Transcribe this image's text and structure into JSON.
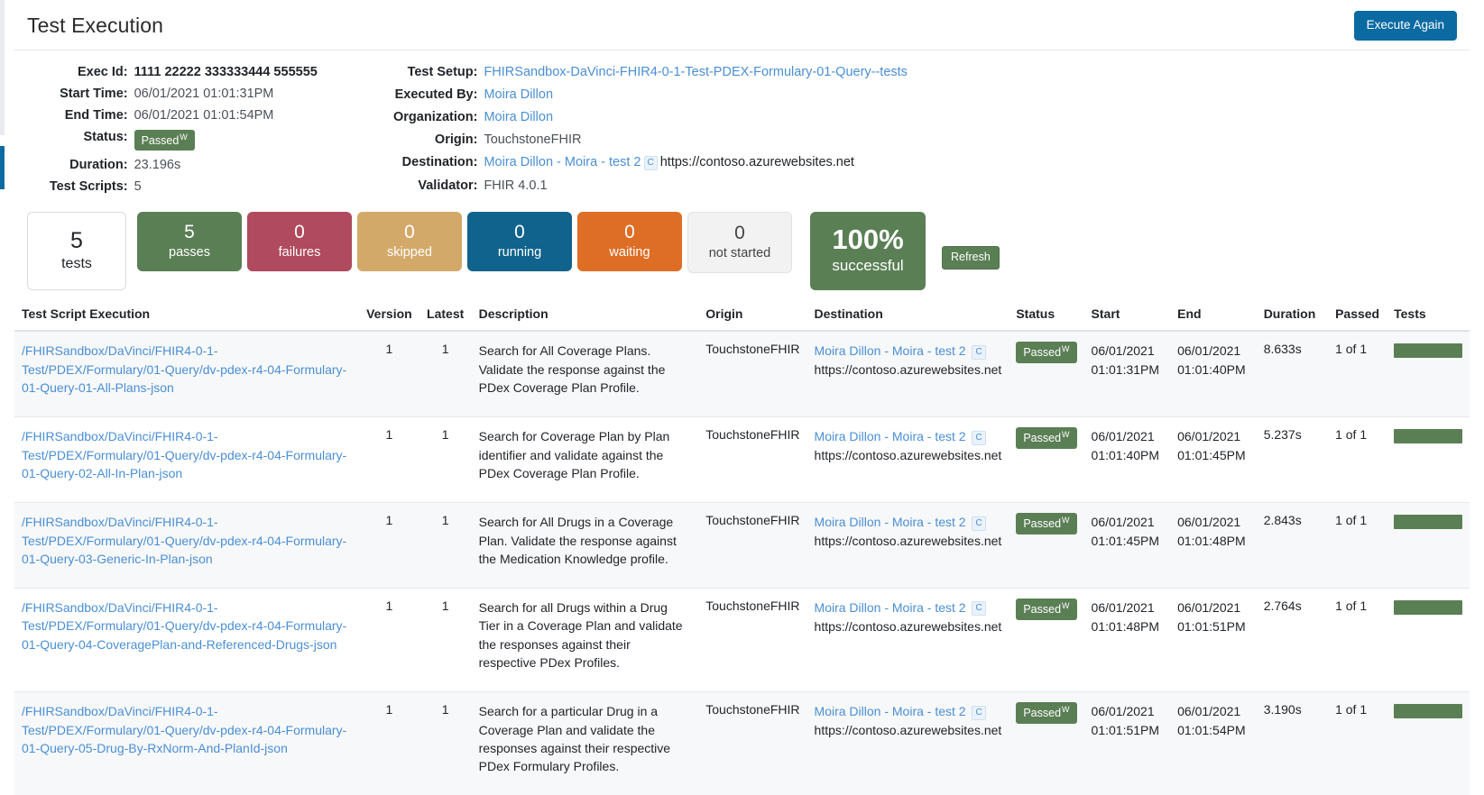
{
  "header": {
    "title": "Test Execution",
    "execute_again_label": "Execute Again"
  },
  "meta": {
    "left": [
      {
        "label": "Exec Id:",
        "value": "1111 22222 333333444 555555",
        "bold": true
      },
      {
        "label": "Start Time:",
        "value": "06/01/2021 01:01:31PM"
      },
      {
        "label": "End Time:",
        "value": "06/01/2021 01:01:54PM"
      },
      {
        "label": "Status:",
        "value": "Passed",
        "badge_sup": "W"
      },
      {
        "label": "Duration:",
        "value": "23.196s"
      },
      {
        "label": "Test Scripts:",
        "value": "5"
      }
    ],
    "right": {
      "test_setup_label": "Test Setup:",
      "test_setup_value": "FHIRSandbox-DaVinci-FHIR4-0-1-Test-PDEX-Formulary-01-Query--tests",
      "executed_by_label": "Executed By:",
      "executed_by_value": "Moira Dillon",
      "organization_label": "Organization:",
      "organization_value": "Moira Dillon",
      "origin_label": "Origin:",
      "origin_value": "TouchstoneFHIR",
      "destination_label": "Destination:",
      "destination_value": "Moira Dillon - Moira - test 2",
      "destination_chip": "C",
      "destination_url": "https://contoso.azurewebsites.net",
      "validator_label": "Validator:",
      "validator_value": "FHIR 4.0.1"
    }
  },
  "stats": {
    "tiles": [
      {
        "num": "5",
        "label": "tests",
        "kind": "tests"
      },
      {
        "num": "5",
        "label": "passes",
        "kind": "passes"
      },
      {
        "num": "0",
        "label": "failures",
        "kind": "failures"
      },
      {
        "num": "0",
        "label": "skipped",
        "kind": "skipped"
      },
      {
        "num": "0",
        "label": "running",
        "kind": "running"
      },
      {
        "num": "0",
        "label": "waiting",
        "kind": "waiting"
      },
      {
        "num": "0",
        "label": "not started",
        "kind": "notstarted"
      }
    ],
    "success": {
      "num": "100%",
      "label": "successful"
    },
    "refresh_label": "Refresh"
  },
  "table": {
    "columns": [
      "Test Script Execution",
      "Version",
      "Latest",
      "Description",
      "Origin",
      "Destination",
      "Status",
      "Start",
      "End",
      "Duration",
      "Passed",
      "Tests"
    ],
    "rows": [
      {
        "script": "/FHIRSandbox/DaVinci/FHIR4-0-1-Test/PDEX/Formulary/01-Query/dv-pdex-r4-04-Formulary-01-Query-01-All-Plans-json",
        "version": "1",
        "latest": "1",
        "description": "Search for All Coverage Plans. Validate the response against the PDex Coverage Plan Profile.",
        "origin": "TouchstoneFHIR",
        "destination": "Moira Dillon - Moira - test 2",
        "destination_chip": "C",
        "destination_url": "https://contoso.azurewebsites.net",
        "status": "Passed",
        "status_sup": "W",
        "start_date": "06/01/2021",
        "start_time": "01:01:31PM",
        "end_date": "06/01/2021",
        "end_time": "01:01:40PM",
        "duration": "8.633s",
        "passed": "1 of 1",
        "tests_bar_pct": 100
      },
      {
        "script": "/FHIRSandbox/DaVinci/FHIR4-0-1-Test/PDEX/Formulary/01-Query/dv-pdex-r4-04-Formulary-01-Query-02-All-In-Plan-json",
        "version": "1",
        "latest": "1",
        "description": "Search for Coverage Plan by Plan identifier and validate against the PDex Coverage Plan Profile.",
        "origin": "TouchstoneFHIR",
        "destination": "Moira Dillon - Moira - test 2",
        "destination_chip": "C",
        "destination_url": "https://contoso.azurewebsites.net",
        "status": "Passed",
        "status_sup": "W",
        "start_date": "06/01/2021",
        "start_time": "01:01:40PM",
        "end_date": "06/01/2021",
        "end_time": "01:01:45PM",
        "duration": "5.237s",
        "passed": "1 of 1",
        "tests_bar_pct": 100
      },
      {
        "script": "/FHIRSandbox/DaVinci/FHIR4-0-1-Test/PDEX/Formulary/01-Query/dv-pdex-r4-04-Formulary-01-Query-03-Generic-In-Plan-json",
        "version": "1",
        "latest": "1",
        "description": "Search for All Drugs in a Coverage Plan. Validate the response against the Medication Knowledge profile.",
        "origin": "TouchstoneFHIR",
        "destination": "Moira Dillon - Moira - test 2",
        "destination_chip": "C",
        "destination_url": "https://contoso.azurewebsites.net",
        "status": "Passed",
        "status_sup": "W",
        "start_date": "06/01/2021",
        "start_time": "01:01:45PM",
        "end_date": "06/01/2021",
        "end_time": "01:01:48PM",
        "duration": "2.843s",
        "passed": "1 of 1",
        "tests_bar_pct": 100
      },
      {
        "script": "/FHIRSandbox/DaVinci/FHIR4-0-1-Test/PDEX/Formulary/01-Query/dv-pdex-r4-04-Formulary-01-Query-04-CoveragePlan-and-Referenced-Drugs-json",
        "version": "1",
        "latest": "1",
        "description": "Search for all Drugs within a Drug Tier in a Coverage Plan and validate the responses against their respective PDex Profiles.",
        "origin": "TouchstoneFHIR",
        "destination": "Moira Dillon - Moira - test 2",
        "destination_chip": "C",
        "destination_url": "https://contoso.azurewebsites.net",
        "status": "Passed",
        "status_sup": "W",
        "start_date": "06/01/2021",
        "start_time": "01:01:48PM",
        "end_date": "06/01/2021",
        "end_time": "01:01:51PM",
        "duration": "2.764s",
        "passed": "1 of 1",
        "tests_bar_pct": 100
      },
      {
        "script": "/FHIRSandbox/DaVinci/FHIR4-0-1-Test/PDEX/Formulary/01-Query/dv-pdex-r4-04-Formulary-01-Query-05-Drug-By-RxNorm-And-PlanId-json",
        "version": "1",
        "latest": "1",
        "description": "Search for a particular Drug in a Coverage Plan and validate the responses against their respective PDex Formulary Profiles.",
        "origin": "TouchstoneFHIR",
        "destination": "Moira Dillon - Moira - test 2",
        "destination_chip": "C",
        "destination_url": "https://contoso.azurewebsites.net",
        "status": "Passed",
        "status_sup": "W",
        "start_date": "06/01/2021",
        "start_time": "01:01:51PM",
        "end_date": "06/01/2021",
        "end_time": "01:01:54PM",
        "duration": "3.190s",
        "passed": "1 of 1",
        "tests_bar_pct": 100
      }
    ]
  },
  "colors": {
    "primary": "#0b6aa2",
    "pass_green": "#5b7f55",
    "fail_red": "#b04a5e",
    "skipped_tan": "#d3a96a",
    "running_blue": "#10638c",
    "waiting_orange": "#de6e26",
    "link_blue": "#4a8fd4"
  }
}
